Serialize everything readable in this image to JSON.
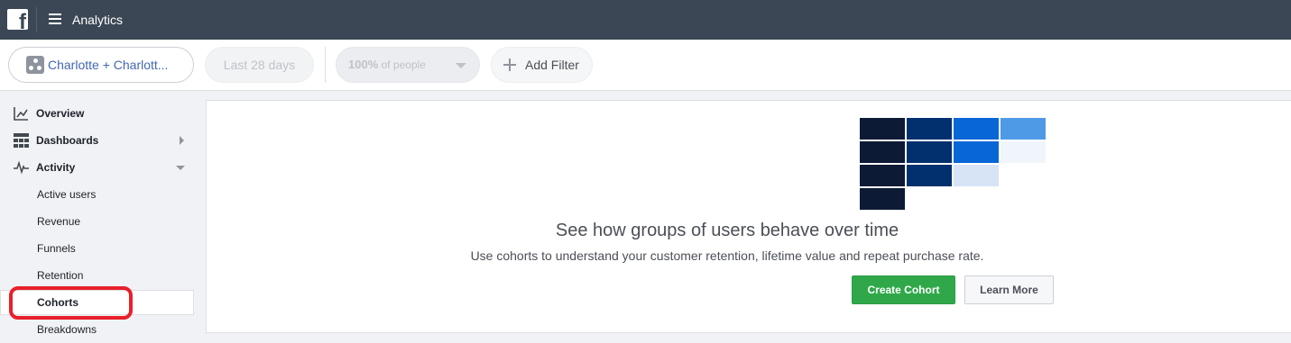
{
  "topbar": {
    "logo_icon": "facebook-logo-icon",
    "menu_icon": "hamburger-menu-icon",
    "title": "Analytics"
  },
  "filters": {
    "segment": {
      "label": "Charlotte + Charlott...",
      "icon": "group-icon"
    },
    "date_range": {
      "label": "Last 28 days"
    },
    "percent": {
      "value": "100%",
      "suffix": "of people",
      "icon": "caret-down-icon"
    },
    "add_filter": {
      "label": "Add Filter",
      "icon": "plus-icon"
    }
  },
  "sidebar": {
    "items": [
      {
        "label": "Overview",
        "icon": "line-chart-icon"
      },
      {
        "label": "Dashboards",
        "icon": "grid-icon",
        "expand": "chevron-right-icon"
      },
      {
        "label": "Activity",
        "icon": "pulse-icon",
        "expand": "chevron-down-icon"
      }
    ],
    "activity_sub_items": [
      {
        "label": "Active users"
      },
      {
        "label": "Revenue"
      },
      {
        "label": "Funnels"
      },
      {
        "label": "Retention"
      },
      {
        "label": "Cohorts",
        "selected": true
      },
      {
        "label": "Breakdowns"
      }
    ]
  },
  "main": {
    "graphic_icon": "cohort-heatmap-illustration",
    "title": "See how groups of users behave over time",
    "description": "Use cohorts to understand your customer retention, lifetime value and repeat purchase rate.",
    "primary_button": "Create Cohort",
    "secondary_button": "Learn More"
  },
  "colors": {
    "topbar": "#3b4754",
    "link": "#4267b2",
    "primary_button": "#30a84a",
    "highlight": "#e8202a",
    "cohort_shades": [
      "#0c1a36",
      "#02306f",
      "#0866d6",
      "#4f9ae6",
      "#d6e4f6",
      "#f0f5fc"
    ]
  }
}
